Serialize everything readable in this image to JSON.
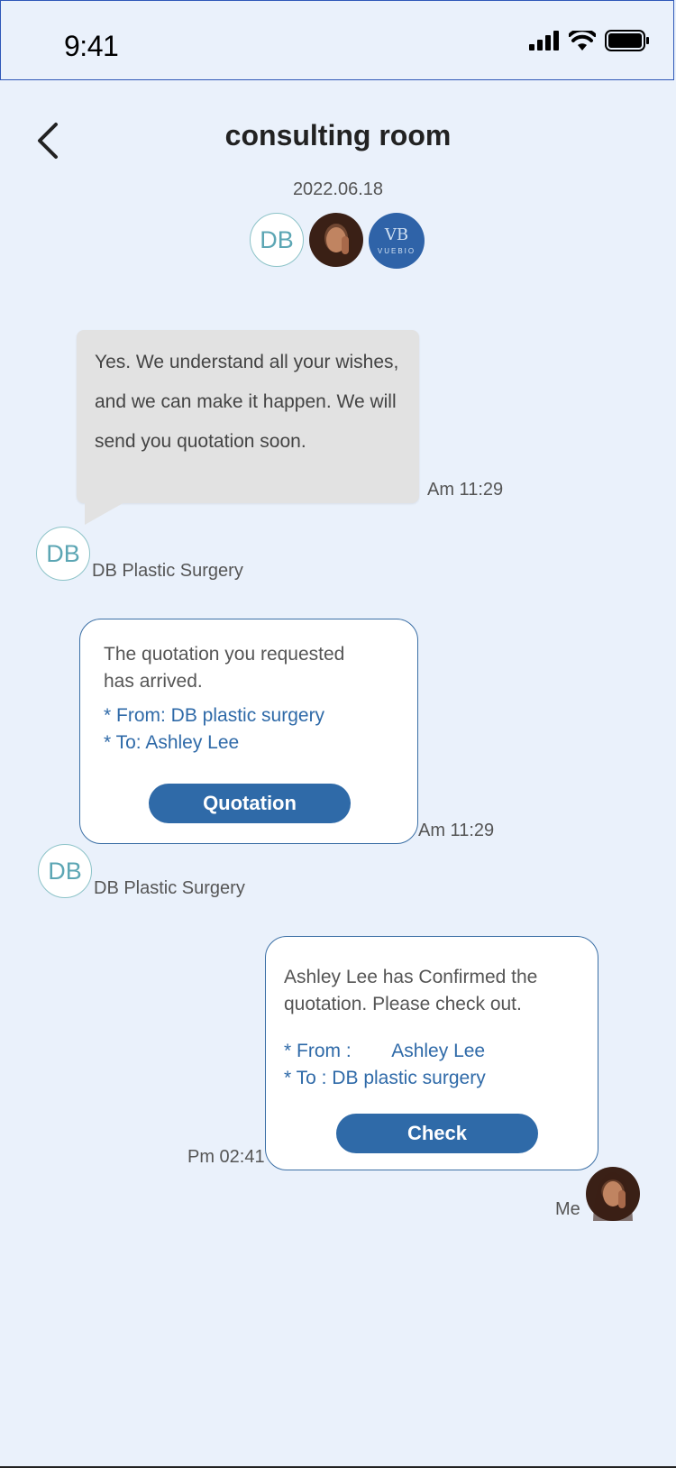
{
  "status_bar": {
    "time": "9:41"
  },
  "header": {
    "title": "consulting room",
    "date": "2022.06.18"
  },
  "participants": {
    "db_initials": "DB",
    "vuebio_monogram": "VB",
    "vuebio_word": "VUEBIO"
  },
  "messages": {
    "m1": {
      "text": "Yes. We understand all your wishes, and we can make it happen. We will send you quotation soon.",
      "time": "Am 11:29",
      "avatar": "DB",
      "sender": "DB Plastic Surgery"
    },
    "m2": {
      "line1": "The quotation you requested",
      "line2": "has arrived.",
      "from": "* From: DB plastic surgery",
      "to": "* To: Ashley Lee",
      "button": "Quotation",
      "time": "Am 11:29",
      "avatar": "DB",
      "sender": "DB Plastic Surgery"
    },
    "m3": {
      "line1": "Ashley Lee has Confirmed the",
      "line2": "quotation.  Please check out.",
      "from_label": "* From :",
      "from_value": "Ashley Lee",
      "to": "* To : DB plastic surgery",
      "button": "Check",
      "time": "Pm 02:41",
      "sender": "Me"
    }
  },
  "colors": {
    "background": "#eaf1fb",
    "accent": "#2f6aa8",
    "db_teal": "#5ca6b4",
    "bubble_gray": "#e2e2e2"
  },
  "icons": [
    "signal-icon",
    "wifi-icon",
    "battery-icon",
    "back-arrow-icon"
  ]
}
